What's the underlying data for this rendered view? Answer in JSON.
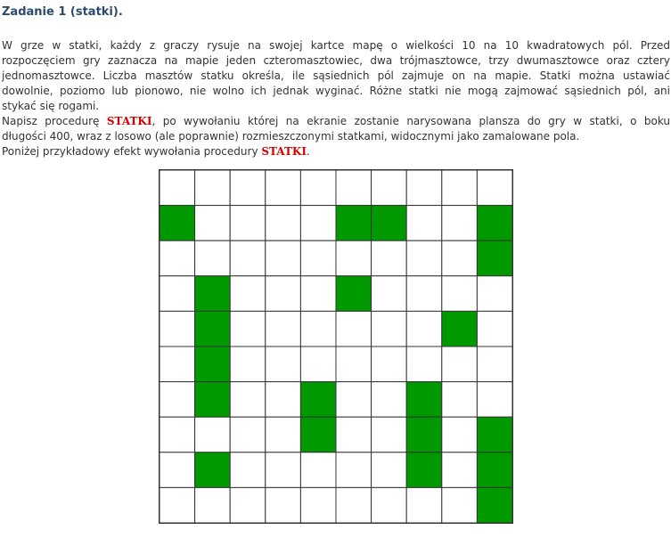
{
  "title": "Zadanie 1 (statki).",
  "paragraph1": [
    "W grze w statki, każdy z graczy rysuje na swojej kartce mapę o wielkości 10 na 10 kwadratowych pól. Przed",
    "rozpoczęciem gry zaznacza na mapie jeden czteromasztowiec, dwa trójmasztowce, trzy dwumasztowce oraz cztery",
    "jednomasztowce. Liczba masztów statku określa, ile sąsiednich pól zajmuje on na mapie. Statki można ustawiać",
    "dowolnie, poziomo lub pionowo, nie wolno ich jednak wyginać. Różne statki nie mogą zajmować sąsiednich pól, ani",
    "stykać się rogami."
  ],
  "paragraph2": {
    "l1_before": "Napisz procedurę ",
    "keyword": "STATKI",
    "l1_after": ", po wywołaniu której na ekranie zostanie narysowana plansza do gry w statki, o boku",
    "l2": "długości 400, wraz z losowo (ale poprawnie) rozmieszczonymi statkami, widocznymi jako zamalowane pola.",
    "l3_before": "Poniżej przykładowy efekt wywołania procedury ",
    "l3_after": "."
  },
  "board": {
    "size": 10,
    "ship_color": "#009900",
    "grid_color": "#333333",
    "filled": [
      [
        1,
        0
      ],
      [
        1,
        5
      ],
      [
        1,
        6
      ],
      [
        1,
        9
      ],
      [
        2,
        9
      ],
      [
        3,
        1
      ],
      [
        3,
        5
      ],
      [
        4,
        1
      ],
      [
        4,
        8
      ],
      [
        5,
        1
      ],
      [
        6,
        1
      ],
      [
        6,
        4
      ],
      [
        6,
        7
      ],
      [
        7,
        4
      ],
      [
        7,
        7
      ],
      [
        7,
        9
      ],
      [
        8,
        1
      ],
      [
        8,
        7
      ],
      [
        8,
        9
      ],
      [
        9,
        9
      ]
    ]
  }
}
